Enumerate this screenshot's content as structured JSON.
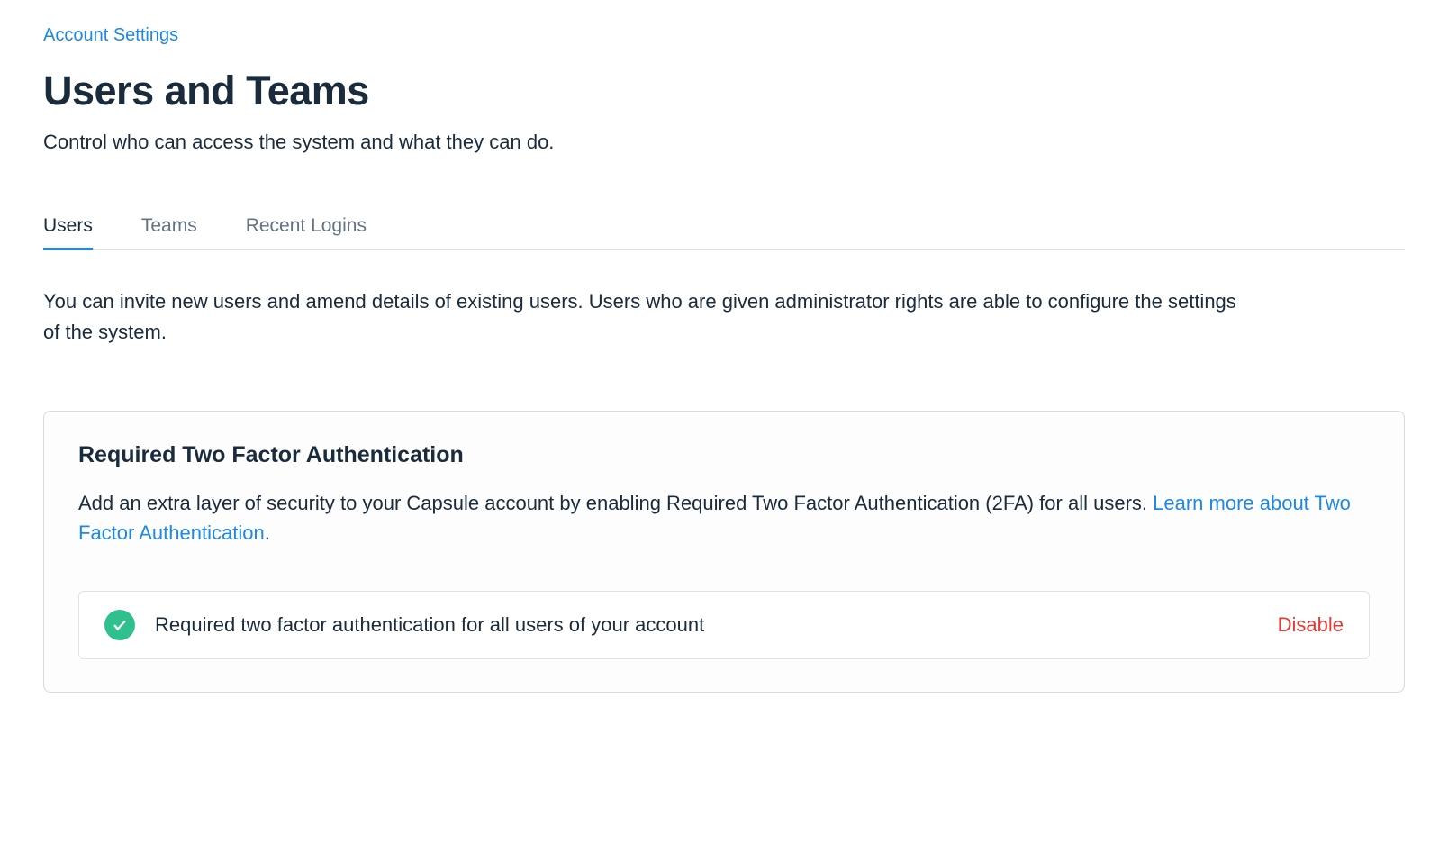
{
  "breadcrumb": {
    "label": "Account Settings"
  },
  "page": {
    "title": "Users and Teams",
    "subtitle": "Control who can access the system and what they can do."
  },
  "tabs": {
    "items": [
      {
        "label": "Users",
        "active": true
      },
      {
        "label": "Teams",
        "active": false
      },
      {
        "label": "Recent Logins",
        "active": false
      }
    ],
    "description": "You can invite new users and amend details of existing users. Users who are given administrator rights are able to configure the settings of the system."
  },
  "tfa_panel": {
    "title": "Required Two Factor Authentication",
    "description_lead": "Add an extra layer of security to your Capsule account by enabling Required Two Factor Authentication (2FA) for all users. ",
    "learn_more_label": "Learn more about Two Factor Authentication",
    "status_text": "Required two factor authentication for all users of your account",
    "action_label": "Disable"
  }
}
